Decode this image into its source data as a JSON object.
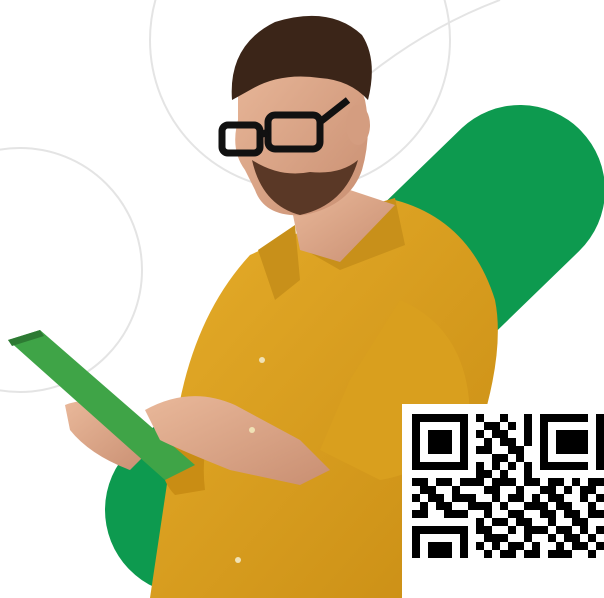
{
  "scene": {
    "background": "#ffffff",
    "accent_green": "#0d9a4f",
    "shirt_color": "#d8a01e",
    "tablet_color": "#3fa447",
    "outline_color": "#e3e3e3"
  },
  "qr_code": {
    "icon": "qr-code-icon",
    "modules": [
      "111111101001001011111101",
      "100000100110101010000001",
      "101110101011001010111101",
      "101110100101101010111101",
      "101110101100110010111101",
      "100000100011010010000001",
      "111111101010101011111101",
      "000000001101001000000000",
      "110110111011101101101011",
      "011001000110010011010110",
      "101101110010110101100101",
      "010110011101001110110010",
      "110011100100110011011011",
      "000000001011011001001100",
      "111111101100101110110101",
      "100000100111001001011010",
      "101110101010110100101101",
      "101110100101101101110010"
    ]
  }
}
